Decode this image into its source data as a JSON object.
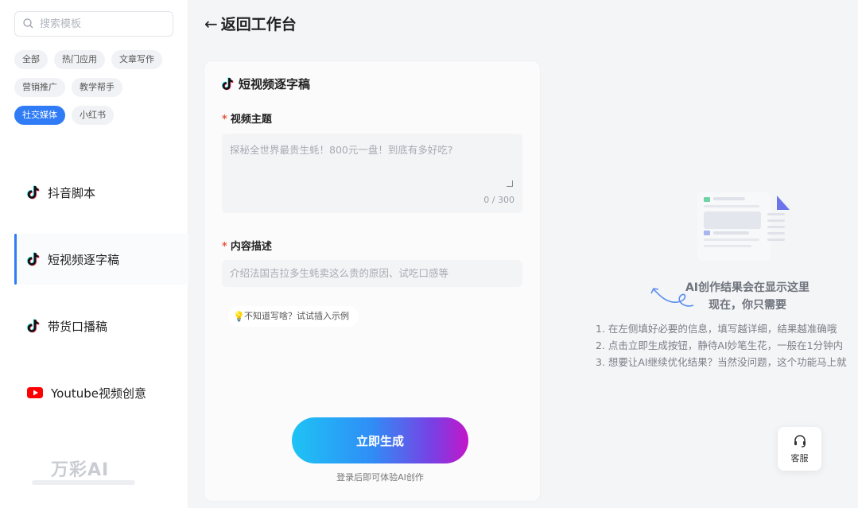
{
  "sidebar": {
    "search_placeholder": "搜索模板",
    "categories": [
      {
        "label": "全部"
      },
      {
        "label": "热门应用"
      },
      {
        "label": "文章写作"
      },
      {
        "label": "营销推广"
      },
      {
        "label": "教学帮手"
      },
      {
        "label": "社交媒体"
      },
      {
        "label": "小红书"
      }
    ],
    "active_category": "社交媒体",
    "templates": [
      {
        "label": "抖音脚本",
        "icon": "tiktok-icon"
      },
      {
        "label": "短视频逐字稿",
        "icon": "tiktok-icon"
      },
      {
        "label": "带货口播稿",
        "icon": "tiktok-icon"
      },
      {
        "label": "Youtube视频创意",
        "icon": "youtube-icon"
      }
    ],
    "active_template": "短视频逐字稿",
    "brand": "万彩AI"
  },
  "header": {
    "back_label": "返回工作台"
  },
  "form": {
    "title": "短视频逐字稿",
    "field1": {
      "required_mark": "*",
      "label": "视频主题",
      "placeholder": "探秘全世界最贵生蚝！800元一盘！到底有多好吃?",
      "counter": "0 / 300"
    },
    "field2": {
      "required_mark": "*",
      "label": "内容描述",
      "placeholder": "介绍法国吉拉多生蚝卖这么贵的原因、试吃口感等"
    },
    "hint": "不知道写啥？试试插入示例",
    "generate_label": "立即生成",
    "login_tip": "登录后即可体验AI创作"
  },
  "result": {
    "title_line1": "AI创作结果会在显示这里",
    "title_line2": "现在，你只需要",
    "steps": [
      "1. 在左侧填好必要的信息，填写越详细，结果越准确哦",
      "2. 点击立即生成按钮，静待AI妙笔生花，一般在1分钟内",
      "3. 想要让AI继续优化结果？当然没问题，这个功能马上就"
    ]
  },
  "service": {
    "label": "客服"
  },
  "colors": {
    "accent": "#2f7cf6",
    "required": "#e8553e",
    "tiktok_cyan": "#25f4ee",
    "tiktok_red": "#fe2c55",
    "youtube_red": "#ff0000"
  }
}
